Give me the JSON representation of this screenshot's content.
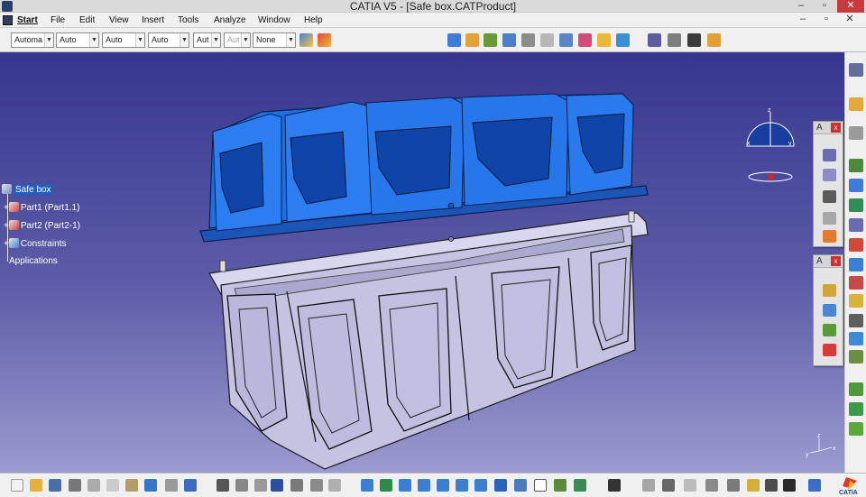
{
  "window": {
    "title": "CATIA V5 - [Safe box.CATProduct]",
    "minimize": "–",
    "restore": "▫",
    "close": "✕"
  },
  "doc_window": {
    "minimize": "–",
    "restore": "▫",
    "close": "✕"
  },
  "menu": {
    "items": [
      "Start",
      "File",
      "Edit",
      "View",
      "Insert",
      "Tools",
      "Analyze",
      "Window",
      "Help"
    ]
  },
  "toolbar": {
    "combos": [
      {
        "value": "Automa",
        "disabled": false
      },
      {
        "value": "Auto",
        "disabled": false
      },
      {
        "value": "Auto",
        "disabled": false
      },
      {
        "value": "Auto",
        "disabled": false
      },
      {
        "value": "Aut",
        "disabled": false
      },
      {
        "value": "Aut",
        "disabled": true
      },
      {
        "value": "None",
        "disabled": false
      }
    ]
  },
  "tree": {
    "root": "Safe box",
    "children": [
      "Part1 (Part1.1)",
      "Part2 (Part2-1)",
      "Constraints",
      "Applications"
    ]
  },
  "compass": {
    "x": "x",
    "y": "y",
    "z": "z"
  },
  "palettes": [
    {
      "title": "A",
      "close": "x"
    },
    {
      "title": "A",
      "close": "x"
    }
  ],
  "axis_triad": {
    "x": "x",
    "y": "y",
    "z": "z"
  },
  "logo": {
    "text": "CATIA"
  },
  "colors": {
    "viewport_top": "#37368f",
    "viewport_bottom": "#9b9bd0",
    "lid": "#1e6fe0",
    "box": "#c9c8e6",
    "selection": "#1d5fbf"
  }
}
